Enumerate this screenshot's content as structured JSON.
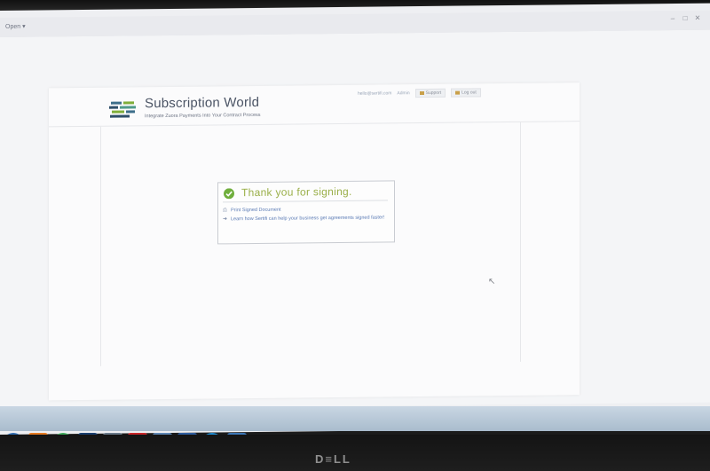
{
  "menubar": {
    "open_label": "Open ▾"
  },
  "site": {
    "brand_name": "Subscription World",
    "tagline": "Integrate Zuora Payments Into Your Contract Process"
  },
  "user_nav": {
    "email": "hello@sertifi.com",
    "role": "Admin",
    "support_label": "Support",
    "logout_label": "Log out"
  },
  "confirmation": {
    "title": "Thank you for signing.",
    "print_link": "Print Signed Document",
    "learn_link": "Learn how Sertifi can help your business get agreements signed faster!"
  },
  "colors": {
    "accent_green": "#9bb04a",
    "link_blue": "#5b7bb5",
    "brand_text": "#4c5566"
  },
  "taskbar_icons": [
    "start-orb",
    "firefox",
    "chrome",
    "photoshop",
    "stock-app",
    "acrobat",
    "explorer",
    "app-bracket",
    "skype",
    "remote-desktop"
  ]
}
